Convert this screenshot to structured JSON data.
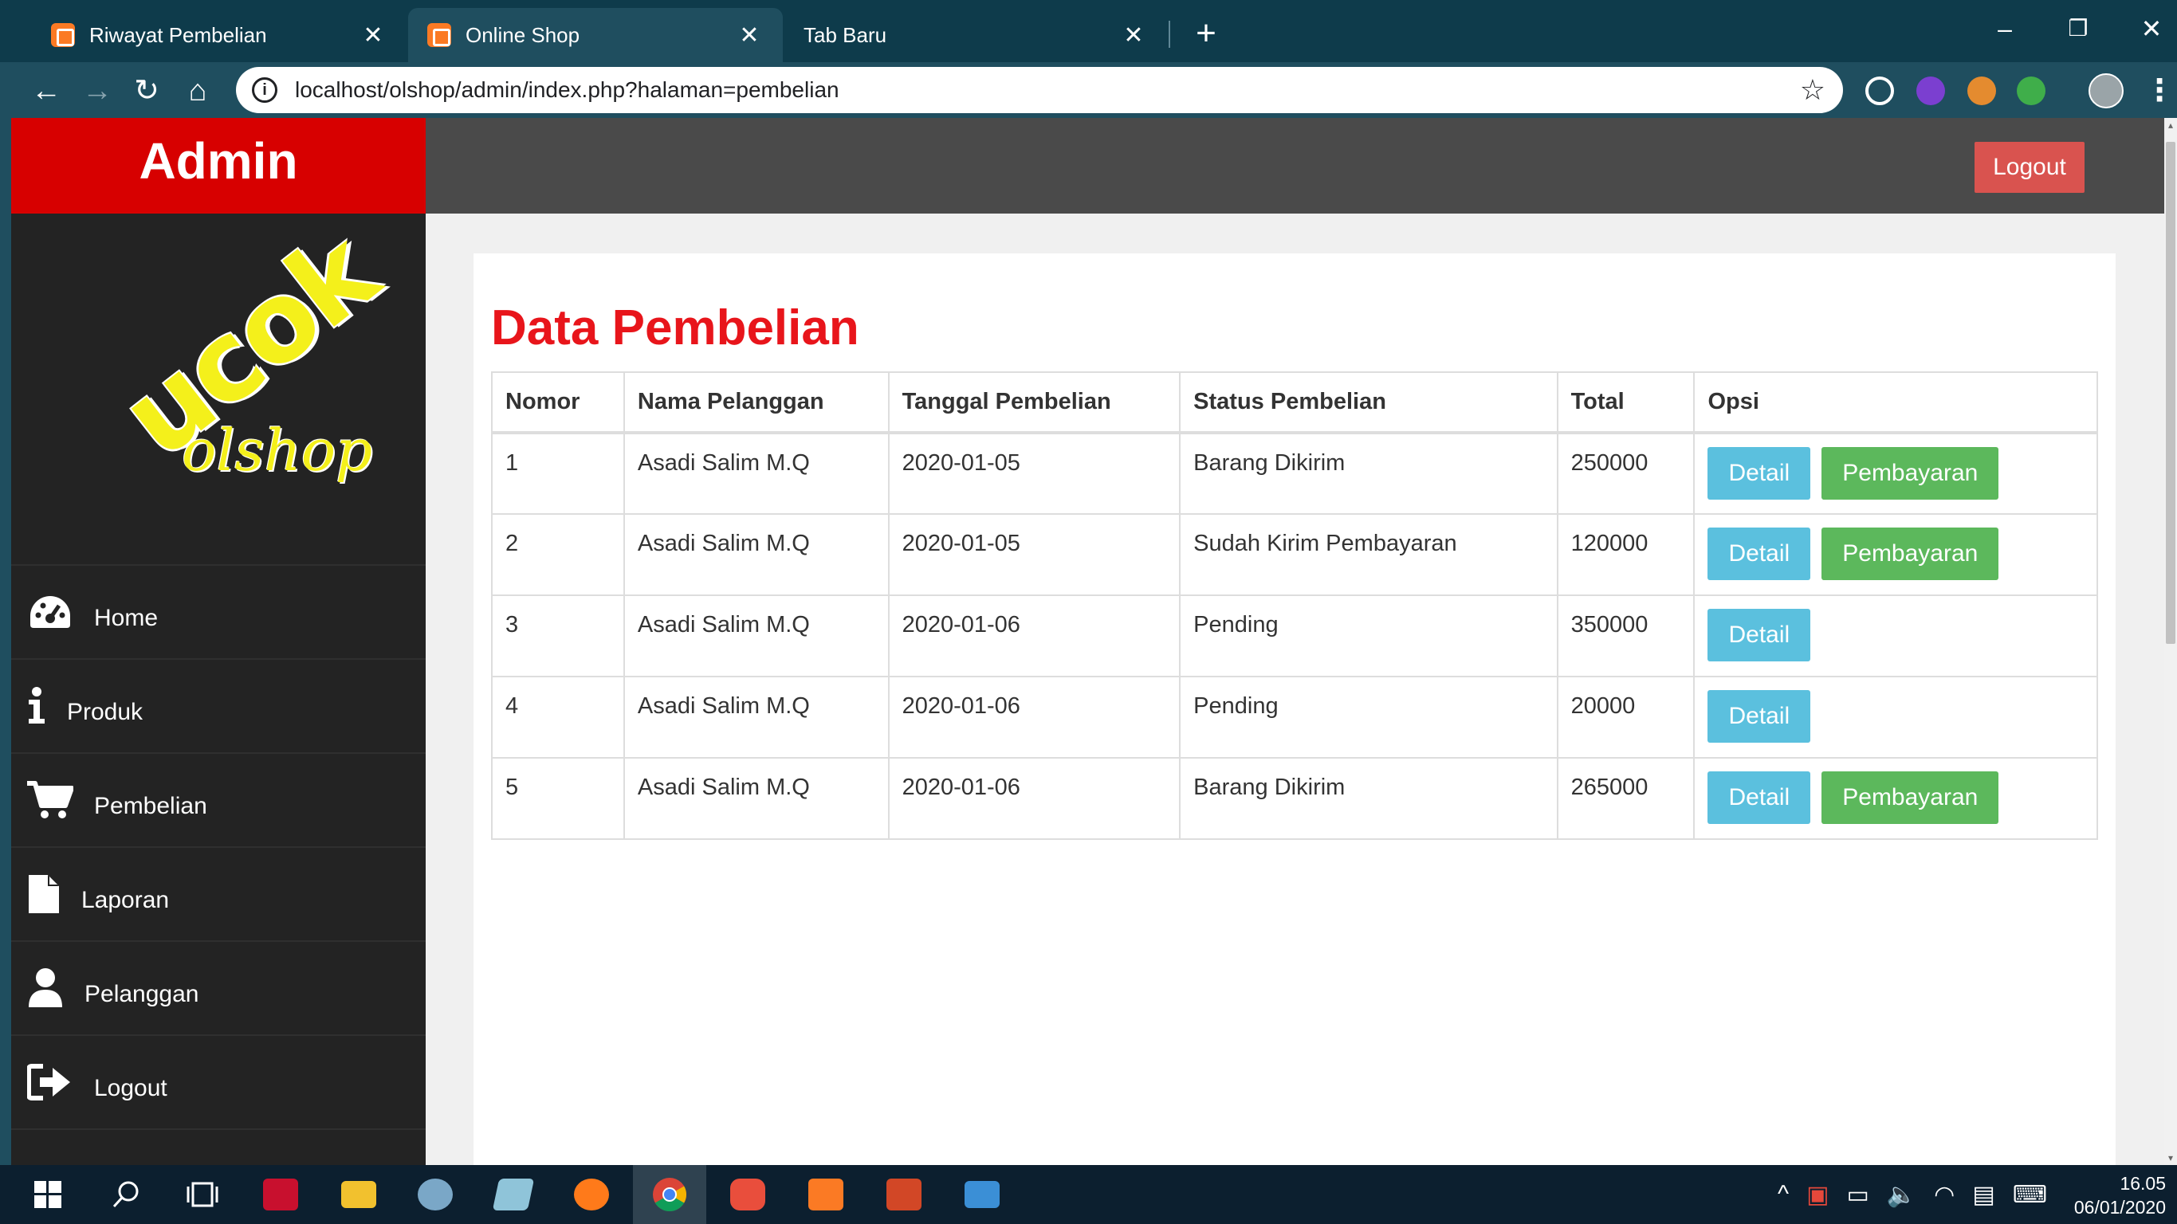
{
  "browser": {
    "tabs": [
      {
        "title": "Riwayat Pembelian",
        "active": false
      },
      {
        "title": "Online Shop",
        "active": true
      },
      {
        "title": "Tab Baru",
        "active": false
      }
    ],
    "url": "localhost/olshop/admin/index.php?halaman=pembelian"
  },
  "sidebar": {
    "brand": "Admin",
    "logo_main": "ucok",
    "logo_sub": "olshop",
    "menu": [
      {
        "label": "Home",
        "icon": "dashboard-icon"
      },
      {
        "label": "Produk",
        "icon": "info-icon"
      },
      {
        "label": "Pembelian",
        "icon": "cart-icon"
      },
      {
        "label": "Laporan",
        "icon": "file-icon"
      },
      {
        "label": "Pelanggan",
        "icon": "user-icon"
      },
      {
        "label": "Logout",
        "icon": "sign-out-icon"
      }
    ]
  },
  "header": {
    "logout_label": "Logout"
  },
  "main": {
    "title": "Data Pembelian",
    "columns": [
      "Nomor",
      "Nama Pelanggan",
      "Tanggal Pembelian",
      "Status Pembelian",
      "Total",
      "Opsi"
    ],
    "detail_label": "Detail",
    "payment_label": "Pembayaran",
    "rows": [
      {
        "nomor": "1",
        "nama": "Asadi Salim M.Q",
        "tanggal": "2020-01-05",
        "status": "Barang Dikirim",
        "total": "250000",
        "has_payment": true
      },
      {
        "nomor": "2",
        "nama": "Asadi Salim M.Q",
        "tanggal": "2020-01-05",
        "status": "Sudah Kirim Pembayaran",
        "total": "120000",
        "has_payment": true
      },
      {
        "nomor": "3",
        "nama": "Asadi Salim M.Q",
        "tanggal": "2020-01-06",
        "status": "Pending",
        "total": "350000",
        "has_payment": false
      },
      {
        "nomor": "4",
        "nama": "Asadi Salim M.Q",
        "tanggal": "2020-01-06",
        "status": "Pending",
        "total": "20000",
        "has_payment": false
      },
      {
        "nomor": "5",
        "nama": "Asadi Salim M.Q",
        "tanggal": "2020-01-06",
        "status": "Barang Dikirim",
        "total": "265000",
        "has_payment": true
      }
    ]
  },
  "taskbar": {
    "time": "16.05",
    "date": "06/01/2020"
  },
  "colors": {
    "brand_red": "#d70000",
    "title_red": "#e8151b",
    "detail_blue": "#5bc0de",
    "payment_green": "#5cb85c",
    "logout_red": "#d9534f",
    "logo_yellow": "#f4f01b"
  }
}
